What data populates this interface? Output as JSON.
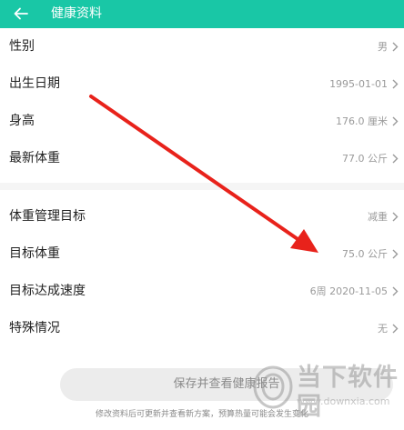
{
  "header": {
    "title": "健康资料",
    "back_icon": "arrow-left-icon",
    "color": "#19c7a6"
  },
  "profile": [
    {
      "label": "性别",
      "value": "男"
    },
    {
      "label": "出生日期",
      "value": "1995-01-01"
    },
    {
      "label": "身高",
      "value": "176.0 厘米"
    },
    {
      "label": "最新体重",
      "value": "77.0 公斤"
    }
  ],
  "goals": [
    {
      "label": "体重管理目标",
      "value": "减重"
    },
    {
      "label": "目标体重",
      "value": "75.0 公斤"
    },
    {
      "label": "目标达成速度",
      "value": "6周 2020-11-05"
    },
    {
      "label": "特殊情况",
      "value": "无"
    }
  ],
  "save": {
    "label": "保存并查看健康报告"
  },
  "footnote": "修改资料后可更新并查看新方案，预算热量可能会发生变化",
  "annotation": {
    "color": "#e8221b"
  },
  "watermark": {
    "name": "当下软件园",
    "url": "www.downxia.com"
  }
}
